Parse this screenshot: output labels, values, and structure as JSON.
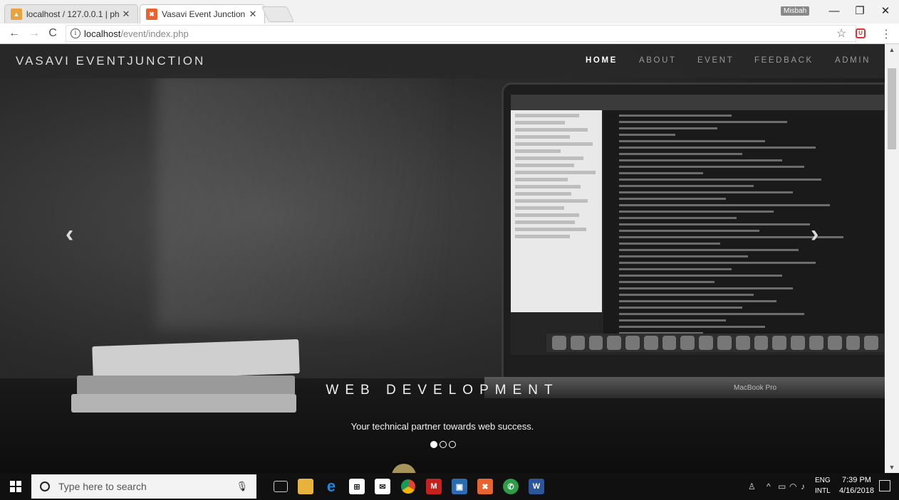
{
  "browser": {
    "tabs": [
      {
        "label": "localhost / 127.0.0.1 | ph",
        "active": false
      },
      {
        "label": "Vasavi Event Junction",
        "active": true
      }
    ],
    "profile_label": "Misbah",
    "url_host": "localhost",
    "url_path": "/event/index.php"
  },
  "site": {
    "logo": "VASAVI EVENTJUNCTION",
    "nav": [
      "HOME",
      "ABOUT",
      "EVENT",
      "FEEDBACK",
      "ADMIN"
    ],
    "active_nav": "HOME"
  },
  "carousel": {
    "title": "WEB DEVELOPMENT",
    "subtitle": "Your technical partner towards web success.",
    "laptop_brand": "MacBook Pro",
    "slide_count": 3,
    "active_slide": 1
  },
  "taskbar": {
    "search_placeholder": "Type here to search",
    "lang_top": "ENG",
    "lang_bottom": "INTL",
    "time": "7:39 PM",
    "date": "4/16/2018"
  }
}
